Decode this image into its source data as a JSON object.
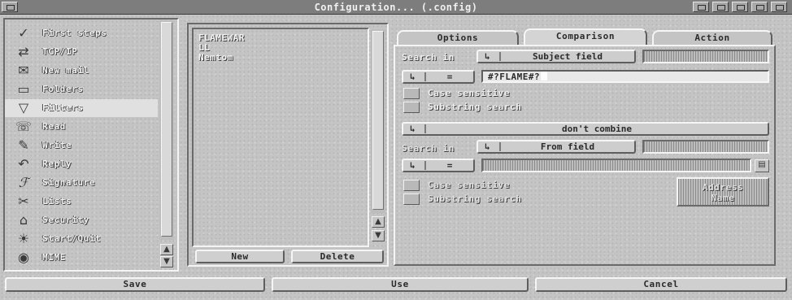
{
  "window": {
    "title": "Configuration... (.config)"
  },
  "nav": {
    "items": [
      {
        "label": "First steps",
        "icon": "checkmark-icon"
      },
      {
        "label": "TCP/IP",
        "icon": "network-icon"
      },
      {
        "label": "New mail",
        "icon": "envelope-icon"
      },
      {
        "label": "Folders",
        "icon": "folder-icon"
      },
      {
        "label": "Filters",
        "icon": "filter-funnel-icon",
        "selected": true
      },
      {
        "label": "Read",
        "icon": "read-mail-icon"
      },
      {
        "label": "Write",
        "icon": "quill-pen-icon"
      },
      {
        "label": "Reply",
        "icon": "reply-arrow-icon"
      },
      {
        "label": "Signature",
        "icon": "signature-icon"
      },
      {
        "label": "Lists",
        "icon": "scissors-icon"
      },
      {
        "label": "Security",
        "icon": "padlock-icon"
      },
      {
        "label": "Start/Quit",
        "icon": "lightbulb-icon"
      },
      {
        "label": "MIME",
        "icon": "eye-icon"
      }
    ]
  },
  "filters": {
    "items": [
      "FLAMEWAR",
      "LL",
      "Nemtom"
    ],
    "new_label": "New",
    "delete_label": "Delete"
  },
  "tabs": [
    "Options",
    "Comparison",
    "Action"
  ],
  "active_tab": "Comparison",
  "comparison1": {
    "search_in_label": "Search in",
    "search_in_value": "Subject field",
    "operator": "=",
    "pattern": "#?FLAME#?",
    "case_sensitive_label": "Case sensitive",
    "substring_label": "Substring search"
  },
  "combine": {
    "value": "don't combine"
  },
  "comparison2": {
    "search_in_label": "Search in",
    "search_in_value": "From field",
    "operator": "=",
    "pattern": "",
    "case_sensitive_label": "Case sensitive",
    "substring_label": "Substring search",
    "address_button_line1": "Address",
    "address_button_line2": "Name"
  },
  "cycle_glyph": "↳",
  "bottom": {
    "save": "Save",
    "use": "Use",
    "cancel": "Cancel"
  }
}
